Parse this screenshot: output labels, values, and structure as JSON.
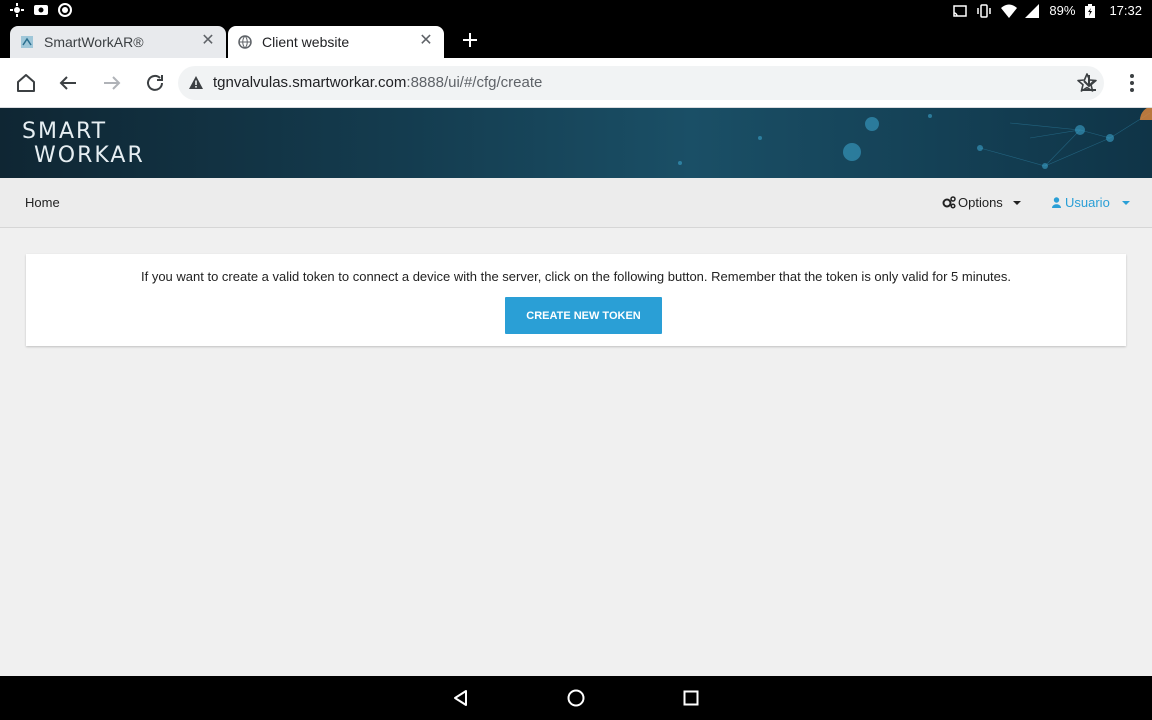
{
  "status_bar": {
    "battery": "89%",
    "time": "17:32"
  },
  "tabs": [
    {
      "title": "SmartWorkAR®",
      "active": false
    },
    {
      "title": "Client website",
      "active": true
    }
  ],
  "address_bar": {
    "host": "tgnvalvulas.smartworkar.com",
    "path": ":8888/ui/#/cfg/create"
  },
  "site": {
    "logo_line1": "SMART",
    "logo_line2": "WORKAR",
    "nav": {
      "home": "Home",
      "options": "Options",
      "user": "Usuario"
    },
    "panel": {
      "message": "If you want to create a valid token to connect a device with the server, click on the following button. Remember that the token is only valid for 5 minutes.",
      "button": "CREATE NEW TOKEN"
    }
  },
  "colors": {
    "accent": "#2a9fd6",
    "banner": "#143c4f"
  }
}
